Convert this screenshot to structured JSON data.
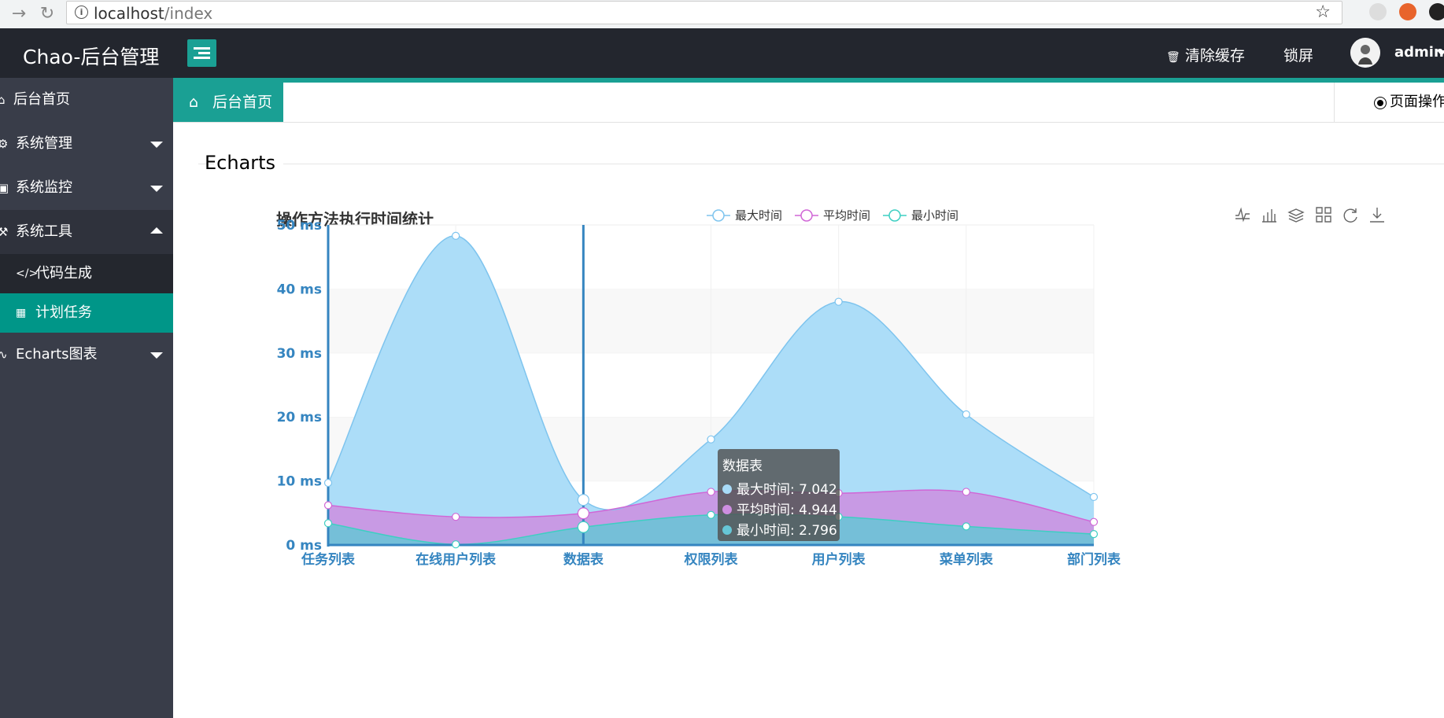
{
  "browser": {
    "url_host": "localhost",
    "url_path": "/index"
  },
  "header": {
    "brand": "Chao-后台管理",
    "clear_cache": "清除缓存",
    "lock_screen": "锁屏",
    "user": "admin"
  },
  "sidebar": {
    "items": [
      {
        "label": "后台首页",
        "icon": "home-icon"
      },
      {
        "label": "系统管理",
        "icon": "gear-icon"
      },
      {
        "label": "系统监控",
        "icon": "monitor-icon"
      },
      {
        "label": "系统工具",
        "icon": "tools-icon"
      },
      {
        "label": "代码生成",
        "icon": "code-icon"
      },
      {
        "label": "计划任务",
        "icon": "table-icon"
      },
      {
        "label": "Echarts图表",
        "icon": "pulse-icon"
      }
    ]
  },
  "tabs": {
    "home": "后台首页",
    "page_ops": "页面操作"
  },
  "section": {
    "title": "Echarts"
  },
  "colors": {
    "sidebar_bg": "#393d49",
    "header_bg": "#23262e",
    "accent": "#1aa094",
    "max_fill": "#a8dbf8",
    "avg_fill": "#cd8ee0",
    "min_fill": "#66c6d6"
  },
  "chart_data": {
    "type": "area",
    "title": "操作方法执行时间统计",
    "categories": [
      "任务列表",
      "在线用户列表",
      "数据表",
      "权限列表",
      "用户列表",
      "菜单列表",
      "部门列表"
    ],
    "series": [
      {
        "name": "最大时间",
        "values": [
          9.7,
          48.3,
          7.042,
          16.5,
          38.0,
          20.4,
          7.5
        ],
        "line": "#7ec4ee",
        "fill": "#a8dbf8"
      },
      {
        "name": "平均时间",
        "values": [
          6.2,
          4.4,
          4.944,
          8.3,
          8.1,
          8.3,
          3.6
        ],
        "line": "#d066d6",
        "fill": "#cd8ee0"
      },
      {
        "name": "最小时间",
        "values": [
          3.4,
          0.1,
          2.796,
          4.7,
          4.4,
          2.9,
          1.7
        ],
        "line": "#3dcfc2",
        "fill": "#66c6d6"
      }
    ],
    "yticks": [
      "0 ms",
      "10 ms",
      "20 ms",
      "30 ms",
      "40 ms",
      "50 ms"
    ],
    "ylim": [
      0,
      50
    ],
    "tooltip": {
      "title": "数据表",
      "rows": [
        "最大时间: 7.042",
        "平均时间: 4.944",
        "最小时间: 2.796"
      ]
    },
    "legend_position": "top-center",
    "toolbox": [
      "line-chart-icon",
      "bar-chart-icon",
      "stack-icon",
      "tiled-icon",
      "refresh-icon",
      "download-icon"
    ]
  }
}
